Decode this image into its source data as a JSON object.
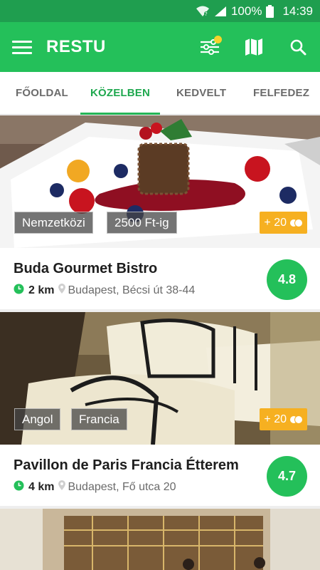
{
  "status": {
    "battery": "100%",
    "time": "14:39"
  },
  "app": {
    "title": "RESTU"
  },
  "tabs": [
    {
      "label": "FŐOLDAL",
      "active": false
    },
    {
      "label": "KÖZELBEN",
      "active": true
    },
    {
      "label": "KEDVELT",
      "active": false
    },
    {
      "label": "FELFEDEZ",
      "active": false
    }
  ],
  "restaurants": [
    {
      "name": "Buda Gourmet Bistro",
      "distance": "2 km",
      "address": "Budapest, Bécsi út 38-44",
      "rating": "4.8",
      "tags": [
        "Nemzetközi",
        "2500 Ft-ig"
      ],
      "points": "+ 20"
    },
    {
      "name": "Pavillon de Paris Francia Étterem",
      "distance": "4 km",
      "address": "Budapest, Fő utca 20",
      "rating": "4.7",
      "tags": [
        "Angol",
        "Francia"
      ],
      "points": "+ 20"
    }
  ],
  "colors": {
    "primary": "#24c05a",
    "status_bar": "#1f9e4f",
    "accent_tab": "#1fa84f",
    "points": "#f6b021"
  }
}
